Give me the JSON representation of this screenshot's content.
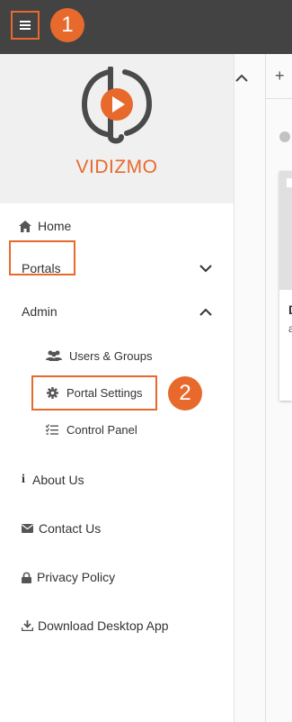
{
  "callouts": {
    "one": "1",
    "two": "2"
  },
  "brand": {
    "name": "VIDIZMO"
  },
  "nav": {
    "home": "Home",
    "portals": "Portals",
    "admin": "Admin",
    "users_groups": "Users & Groups",
    "portal_settings": "Portal Settings",
    "control_panel": "Control Panel",
    "about": "About Us",
    "contact": "Contact Us",
    "privacy": "Privacy Policy",
    "download": "Download Desktop App"
  },
  "right_panel": {
    "plus": "+",
    "card_title_partial": "D",
    "card_sub_partial": "a"
  },
  "colors": {
    "accent": "#e8692c",
    "topbar": "#434343",
    "logo_bg": "#f0f0f0"
  }
}
